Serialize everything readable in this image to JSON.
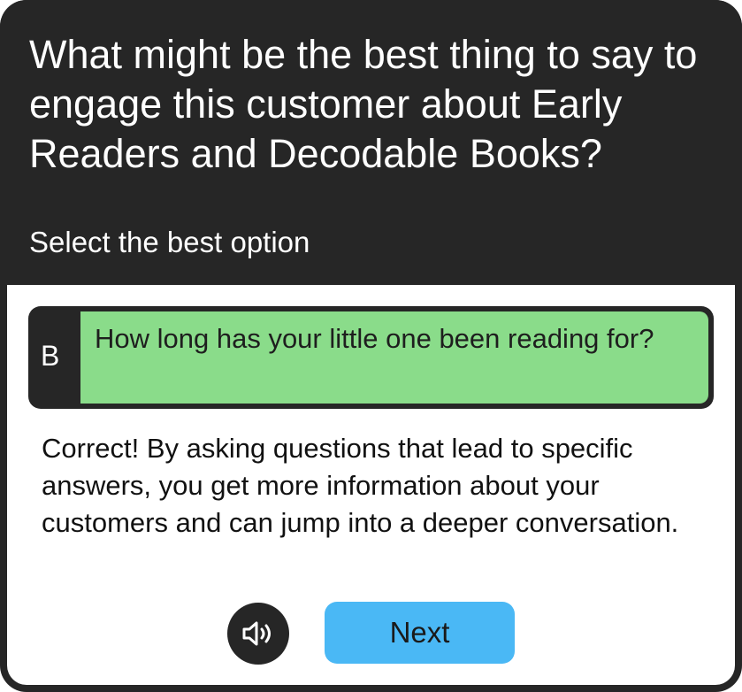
{
  "question": {
    "text": "What might be the best thing to say to engage this customer about Early Readers and Decodable Books?",
    "instruction": "Select the best option"
  },
  "selected_option": {
    "letter": "B",
    "text": "How long has your little one been reading for?",
    "status": "correct",
    "highlight_color": "#8adc8a"
  },
  "feedback": {
    "text": "Correct! By asking questions that lead to specific answers, you get more information about your customers and can jump into a deeper conversation."
  },
  "controls": {
    "audio_icon": "speaker-icon",
    "next_label": "Next",
    "next_color": "#4ab8f5"
  }
}
